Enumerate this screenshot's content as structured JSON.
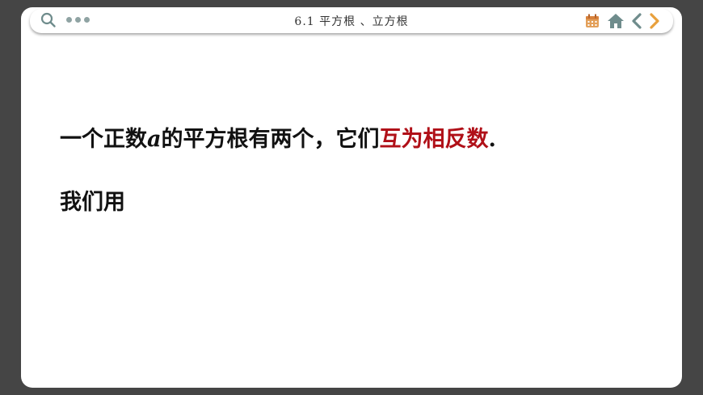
{
  "header": {
    "title": "6.1  平方根  、立方根",
    "icons": [
      "search-icon",
      "more-dots-icon",
      "calendar-icon",
      "home-icon",
      "prev-arrow-icon",
      "next-arrow-icon"
    ]
  },
  "content": {
    "line1_part1": "一个正数",
    "line1_var": "a",
    "line1_part2": "的平方根有两个，它们",
    "line1_highlight": "互为相反数",
    "line1_end": ".",
    "line2": "我们用"
  },
  "colors": {
    "frame": "#454545",
    "accent_icon": "#6f8c8c",
    "calendar": "#e3a05a",
    "next_arrow": "#e8a03c",
    "highlight": "#b01018"
  }
}
